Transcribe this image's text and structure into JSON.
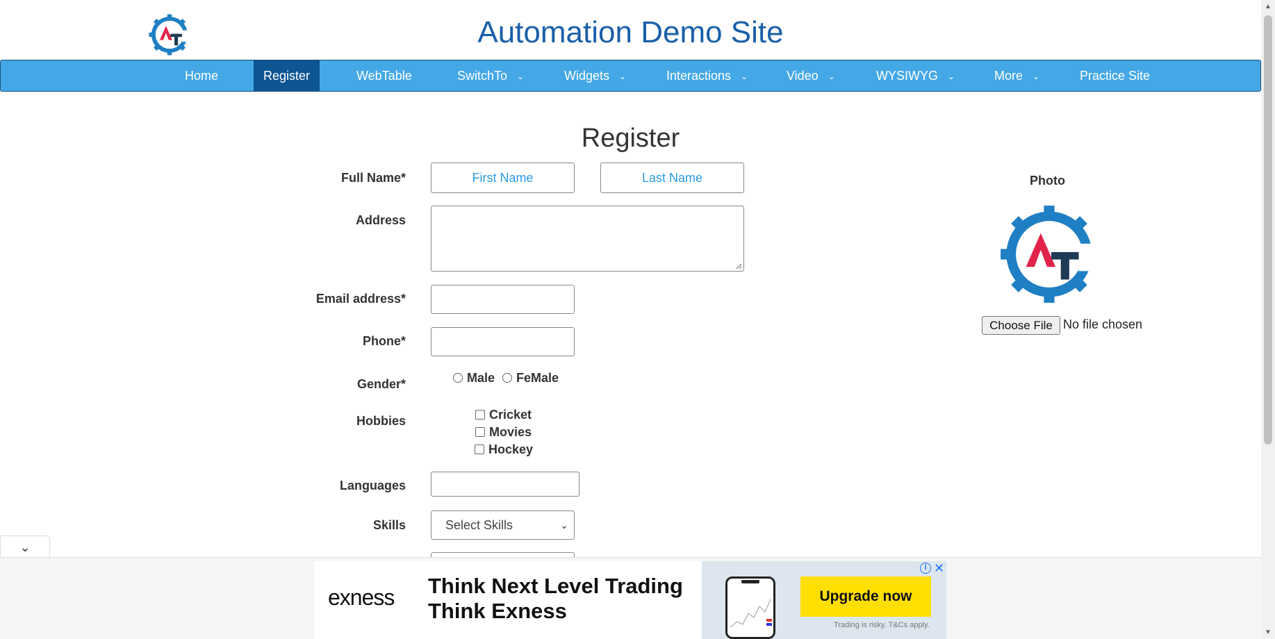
{
  "header": {
    "title": "Automation Demo Site",
    "logo_icon": "gear-logo-icon"
  },
  "nav": {
    "items": [
      {
        "label": "Home"
      },
      {
        "label": "Register",
        "active": true
      },
      {
        "label": "WebTable"
      },
      {
        "label": "SwitchTo",
        "dropdown": true
      },
      {
        "label": "Widgets",
        "dropdown": true
      },
      {
        "label": "Interactions",
        "dropdown": true
      },
      {
        "label": "Video",
        "dropdown": true
      },
      {
        "label": "WYSIWYG",
        "dropdown": true
      },
      {
        "label": "More",
        "dropdown": true
      },
      {
        "label": "Practice Site"
      }
    ],
    "colors": {
      "bar": "#45a8e6",
      "active": "#0d5593"
    }
  },
  "form": {
    "heading": "Register",
    "full_name_label": "Full Name*",
    "first_name_placeholder": "First Name",
    "last_name_placeholder": "Last Name",
    "address_label": "Address",
    "email_label": "Email address*",
    "phone_label": "Phone*",
    "gender_label": "Gender*",
    "gender_options": [
      "Male",
      "FeMale"
    ],
    "hobbies_label": "Hobbies",
    "hobbies": [
      "Cricket",
      "Movies",
      "Hockey"
    ],
    "languages_label": "Languages",
    "skills_label": "Skills",
    "skills_selected": "Select Skills"
  },
  "photo": {
    "label": "Photo",
    "choose_file": "Choose File",
    "file_status": "No file chosen"
  },
  "ad": {
    "brand": "exness",
    "headline_line1": "Think Next Level Trading",
    "headline_line2": "Think Exness",
    "cta": "Upgrade now",
    "disclaimer": "Trading is risky. T&Cs apply."
  }
}
